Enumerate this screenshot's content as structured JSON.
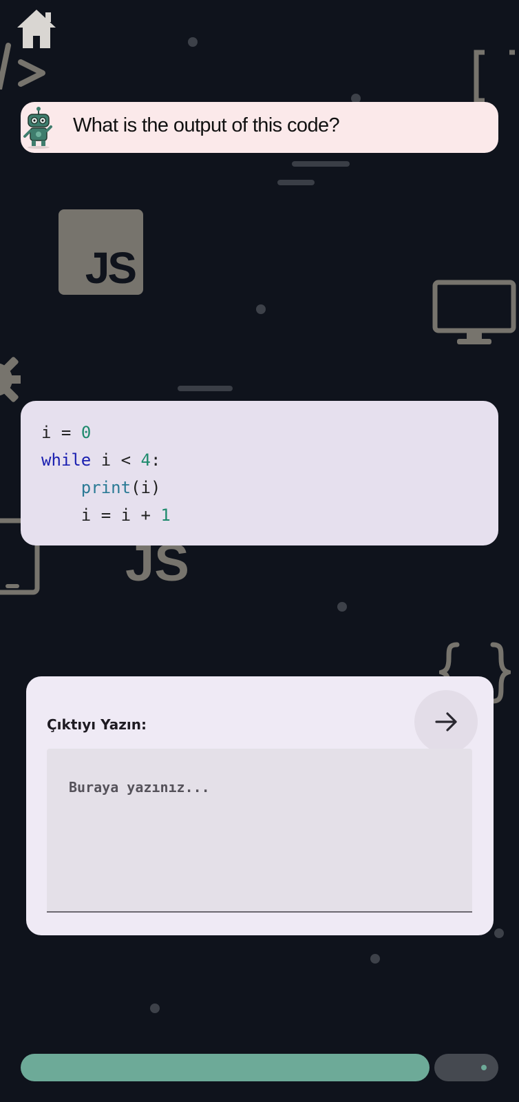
{
  "header": {
    "home_icon": "home-icon"
  },
  "question": {
    "avatar_icon": "robot-icon",
    "text": "What is the output of this code?"
  },
  "code": {
    "line1": {
      "var": "i",
      "op": " = ",
      "num": "0"
    },
    "line2": {
      "kw": "while",
      "rest": " i < ",
      "num": "4",
      "end": ":"
    },
    "line3": {
      "indent": "    ",
      "fn": "print",
      "args": "(i)"
    },
    "line4": {
      "indent": "    ",
      "text": "i = i + ",
      "num": "1"
    }
  },
  "answer": {
    "label": "Çıktıyı Yazın:",
    "placeholder": "Buraya yazınız...",
    "value": "",
    "send_icon": "arrow-right-icon"
  },
  "progress": {
    "value": 0.86,
    "fill_color": "#6daa98",
    "track_color": "#454950"
  },
  "background": {
    "decor_icons": [
      "code-slash-icon",
      "brackets-icon",
      "js-logo-icon",
      "monitor-icon",
      "gear-icon",
      "js-text-icon",
      "tablet-icon",
      "curly-braces-icon"
    ],
    "js_badge": "JS",
    "js_text": "JS"
  },
  "colors": {
    "background": "#0f131c",
    "question_bg": "#fbe9ea",
    "code_bg": "#e6e0ee",
    "keyword": "#1a1fb0",
    "function": "#2b7a95",
    "number": "#1d8a6c",
    "progress": "#6daa98"
  }
}
